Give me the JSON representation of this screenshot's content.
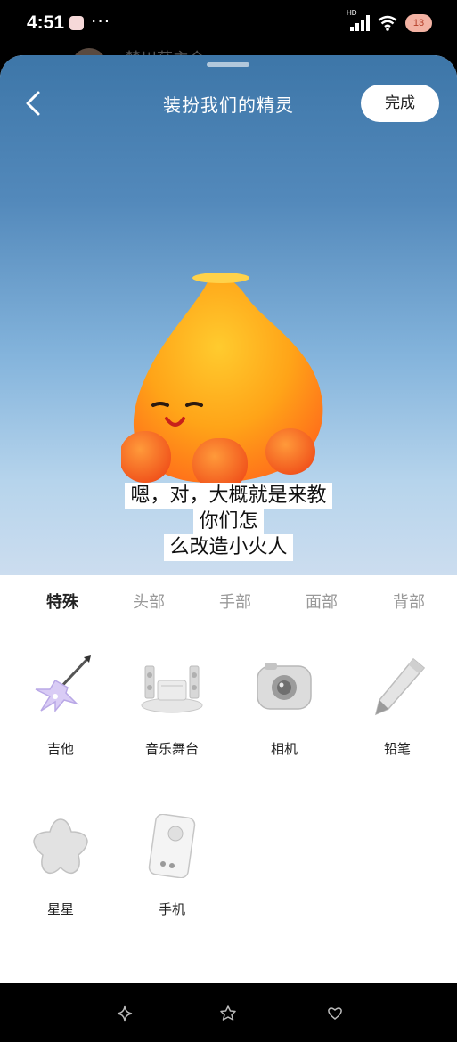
{
  "status_bar": {
    "time": "4:51",
    "dots": "···",
    "network_label": "HD",
    "battery": "13"
  },
  "background": {
    "peek_text": "楚川菇主仓"
  },
  "header": {
    "title": "装扮我们的精灵",
    "done_label": "完成",
    "back_icon": "chevron-left-icon"
  },
  "stage": {
    "gradient_top": "#3d76a8",
    "gradient_bottom": "#ccddef",
    "mascot": "orange-fire-sprite"
  },
  "subtitles": [
    "嗯，对，大概就是来教",
    "你们怎",
    "么改造小火人"
  ],
  "tabs": [
    {
      "label": "特殊",
      "active": true
    },
    {
      "label": "头部",
      "active": false
    },
    {
      "label": "手部",
      "active": false
    },
    {
      "label": "面部",
      "active": false
    },
    {
      "label": "背部",
      "active": false
    }
  ],
  "items": [
    {
      "label": "吉他",
      "icon": "guitar-icon"
    },
    {
      "label": "音乐舞台",
      "icon": "music-stage-icon"
    },
    {
      "label": "相机",
      "icon": "camera-icon"
    },
    {
      "label": "铅笔",
      "icon": "pencil-icon"
    },
    {
      "label": "星星",
      "icon": "star-icon"
    },
    {
      "label": "手机",
      "icon": "phone-icon"
    }
  ],
  "bottom_nav": [
    "sparkle-icon",
    "flower-icon",
    "heart-icon"
  ]
}
